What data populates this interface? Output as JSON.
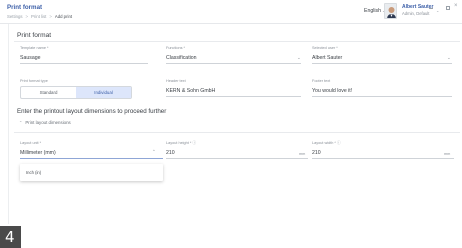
{
  "header": {
    "title": "Print format",
    "breadcrumbs": [
      "Settings",
      "Print list",
      "Add print"
    ],
    "language": "English",
    "user": {
      "name": "Albert Sauter",
      "role": "Admin, Default"
    }
  },
  "section": {
    "title": "Print format"
  },
  "fields": {
    "template_name": {
      "label": "Template name *",
      "value": "Sausage"
    },
    "functions": {
      "label": "Functions *",
      "value": "Classification"
    },
    "selected_user": {
      "label": "Selected user *",
      "value": "Albert Sauter"
    },
    "print_format_type": {
      "label": "Print format type",
      "options": [
        "Standard",
        "Individual"
      ],
      "selected": "Individual"
    },
    "header_text": {
      "label": "Header text",
      "value": "KERN & Sohn GmbH"
    },
    "footer_text": {
      "label": "Footer text",
      "value": "You would love it!"
    }
  },
  "dimensions": {
    "prompt": "Enter the printout layout dimensions to proceed further",
    "collapse_label": "Print layout dimensions",
    "layout_unit": {
      "label": "Layout unit *",
      "value": "Millimeter (mm)"
    },
    "layout_height": {
      "label": "Layout height *",
      "value": "210",
      "unit": "mm"
    },
    "layout_width": {
      "label": "Layout width *",
      "value": "210",
      "unit": "mm"
    },
    "dropdown_options": [
      "Inch (in)"
    ]
  },
  "badge": {
    "number": "4"
  },
  "icons": {
    "chevron_down": "chevron-down-icon",
    "chevron_up": "chevron-up-icon",
    "info": "info-icon",
    "minimize": "minimize-icon",
    "maximize": "maximize-icon",
    "close": "close-icon"
  }
}
